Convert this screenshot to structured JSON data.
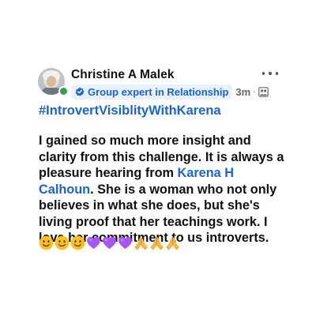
{
  "post": {
    "author": "Christine A Malek",
    "badge_label": "Group expert in Relationship",
    "timestamp": "3m",
    "meta_separator": "·",
    "hashtag": "#IntrovertVisiblityWithKarena",
    "body": {
      "line1": "I gained so much more insight and",
      "line2": "clarity from this challenge. It is always a",
      "line3_prefix": "pleasure hearing from ",
      "mention_part1": "Karena H",
      "mention_part2": "Calhoun",
      "line4_suffix": ".  She is a woman who not only",
      "line5": "believes in what she does, but she's",
      "line6": "living proof that her teachings work. I",
      "line7": "love her commitment to us introverts."
    },
    "emoji_names": [
      "smiling-face-icon",
      "smiling-face-icon",
      "smiling-face-icon",
      "purple-heart-icon",
      "purple-heart-icon",
      "purple-heart-icon",
      "folded-hands-icon",
      "folded-hands-icon",
      "folded-hands-icon"
    ]
  },
  "colors": {
    "link_blue": "#1b63d6",
    "badge_bg": "#e8f1fd",
    "online_green": "#31a24c",
    "text": "#111111",
    "muted": "#65676b"
  }
}
